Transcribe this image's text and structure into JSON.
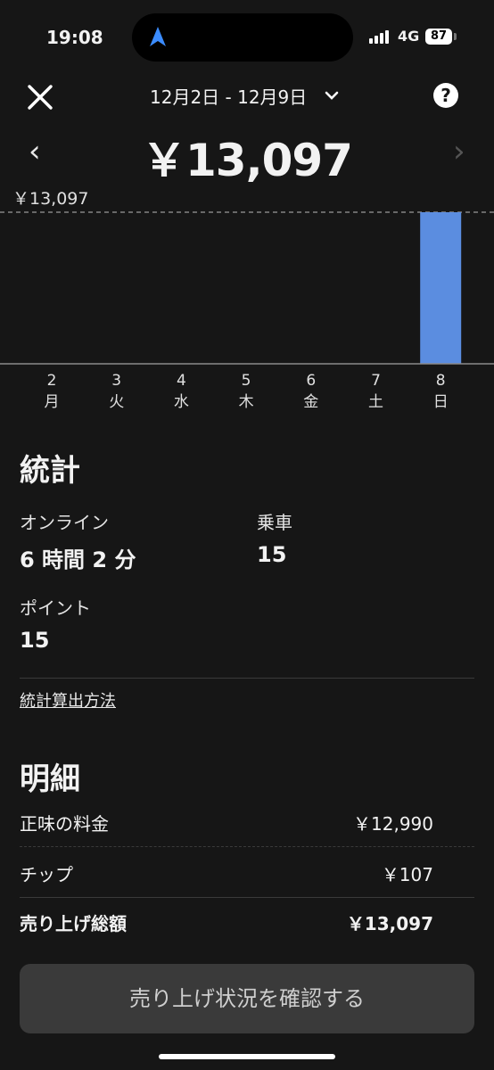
{
  "status": {
    "time": "19:08",
    "network": "4G",
    "battery": "87"
  },
  "header": {
    "date_range": "12月2日 - 12月9日",
    "total": "￥13,097"
  },
  "chart_data": {
    "type": "bar",
    "categories": [
      "2 月",
      "3 火",
      "4 水",
      "5 木",
      "6 金",
      "7 土",
      "8 日"
    ],
    "day_numbers": [
      "2",
      "3",
      "4",
      "5",
      "6",
      "7",
      "8"
    ],
    "weekdays": [
      "月",
      "火",
      "水",
      "木",
      "金",
      "土",
      "日"
    ],
    "values": [
      0,
      0,
      0,
      0,
      0,
      0,
      13097
    ],
    "max_label": "￥13,097",
    "ylim": [
      0,
      13097
    ],
    "bar_color": "#5b8de0"
  },
  "stats": {
    "title": "統計",
    "online_label": "オンライン",
    "online_value": "6 時間 2 分",
    "rides_label": "乗車",
    "rides_value": "15",
    "points_label": "ポイント",
    "points_value": "15",
    "method_link": "統計算出方法"
  },
  "detail": {
    "title": "明細",
    "rows": [
      {
        "label": "正味の料金",
        "value": "￥12,990"
      },
      {
        "label": "チップ",
        "value": "￥107"
      },
      {
        "label": "売り上げ総額",
        "value": "￥13,097"
      }
    ]
  },
  "action": {
    "button_label": "売り上げ状況を確認する"
  }
}
